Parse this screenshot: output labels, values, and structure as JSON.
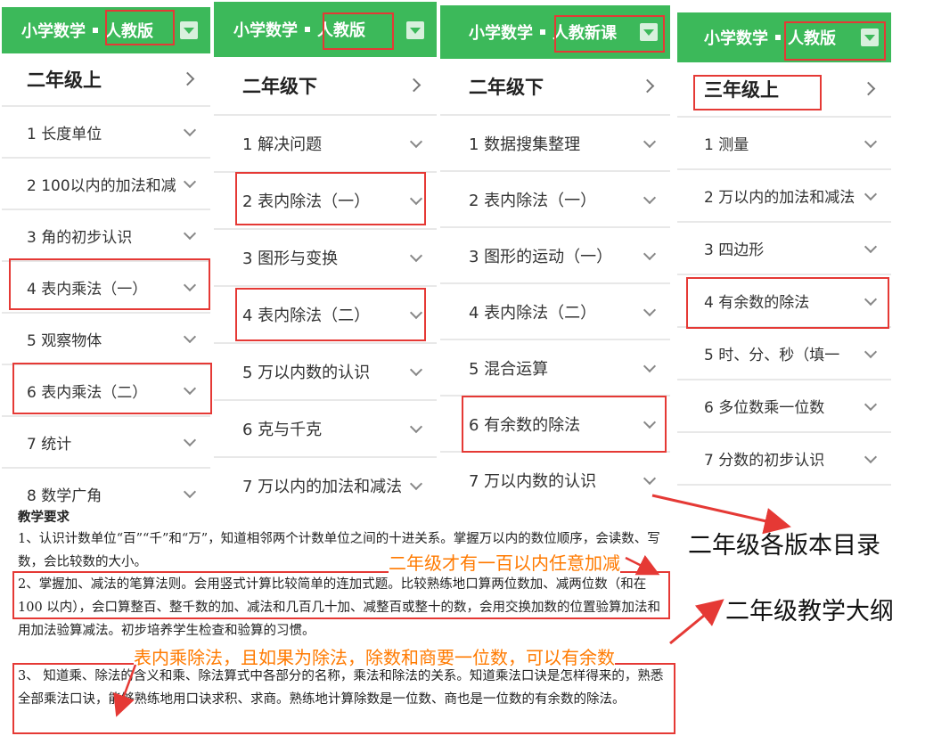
{
  "panels": [
    {
      "subject": "小学数学",
      "edition": "人教版",
      "grade": "二年级上",
      "items": [
        "1 长度单位",
        "2 100以内的加法和减",
        "3 角的初步认识",
        "4 表内乘法（一）",
        "5 观察物体",
        "6 表内乘法（二）",
        "7 统计",
        "8 数学广角"
      ]
    },
    {
      "subject": "小学数学",
      "edition": "人教版",
      "grade": "二年级下",
      "items": [
        "1 解决问题",
        "2 表内除法（一）",
        "3 图形与变换",
        "4 表内除法（二）",
        "5 万以内数的认识",
        "6 克与千克",
        "7 万以内的加法和减法"
      ]
    },
    {
      "subject": "小学数学",
      "edition": "人教新课",
      "grade": "二年级下",
      "items": [
        "1 数据搜集整理",
        "2 表内除法（一）",
        "3 图形的运动（一）",
        "4 表内除法（二）",
        "5 混合运算",
        "6 有余数的除法",
        "7 万以内数的认识"
      ]
    },
    {
      "subject": "小学数学",
      "edition": "人教版",
      "grade": "三年级上",
      "items": [
        "1 测量",
        "2 万以内的加法和减法",
        "3 四边形",
        "4 有余数的除法",
        "5 时、分、秒（填一",
        "6 多位数乘一位数",
        "7 分数的初步认识"
      ]
    }
  ],
  "syllabus": {
    "title": "教学要求",
    "p1": "1、认识计数单位“百”“千”和“万”，知道相邻两个计数单位之间的十进关系。掌握万以内的数位顺序，会读数、写数，会比较数的大小。",
    "p2": "2、掌握加、减法的笔算法则。会用竖式计算比较简单的连加式题。比较熟练地口算两位数加、减两位数（和在 100 以内），会口算整百、整千数的加、减法和几百几十加、减整百或整十的数，会用交换加数的位置验算加法和用加法验算减法。初步培养学生检查和验算的习惯。",
    "p3": "3、 知道乘、除法的含义和乘、除法算式中各部分的名称，乘法和除法的关系。知道乘法口诀是怎样得来的，熟悉全部乘法口诀，能够熟练地用口诀求积、求商。熟练地计算除数是一位数、商也是一位数的有余数的除法。"
  },
  "annotations": {
    "note1": "二年级才有一百以内任意加减",
    "note2": "表内乘除法，且如果为除法，除数和商要一位数，可以有余数",
    "label1": "二年级各版本目录",
    "label2": "二年级教学大纲"
  },
  "colors": {
    "header_green": "#3cb95a",
    "highlight_red": "#e53935",
    "note_orange": "#ff7a00"
  }
}
